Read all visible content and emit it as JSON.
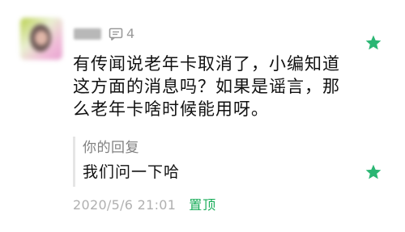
{
  "comment": {
    "avatar_icon": "user-avatar-blurred",
    "username": "",
    "count_icon": "comment-icon",
    "count": "4",
    "text": "有传闻说老年卡取消了，小编知道这方面的消息吗？如果是谣言，那么老年卡啥时候能用呀。",
    "star_icon": "star-icon",
    "star_color": "#2ab673"
  },
  "reply": {
    "label": "你的回复",
    "text": "我们问一下哈",
    "star_icon": "star-icon"
  },
  "footer": {
    "timestamp": "2020/5/6 21:01",
    "pin_label": "置顶",
    "pin_color": "#1aad5a"
  }
}
